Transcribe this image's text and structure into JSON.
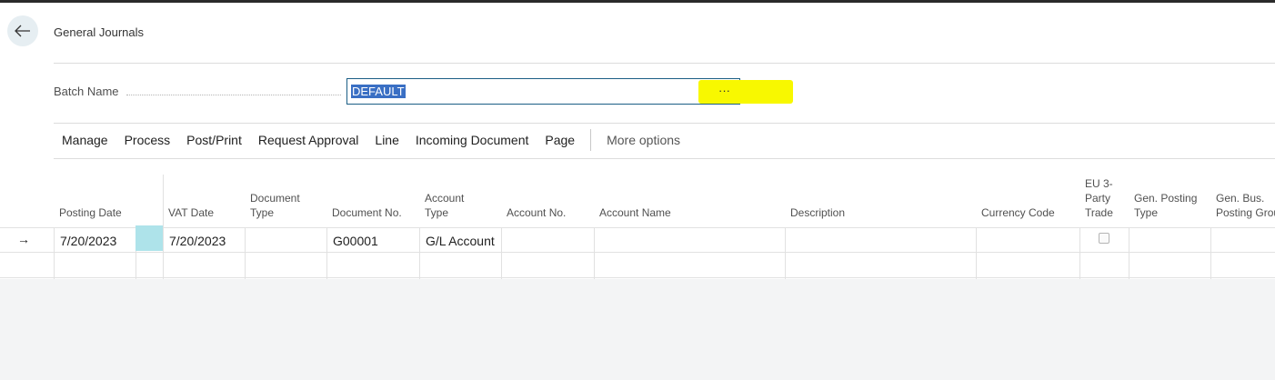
{
  "page": {
    "title": "General Journals"
  },
  "batch": {
    "label": "Batch Name",
    "value": "DEFAULT",
    "lookup": "···"
  },
  "actions": {
    "items": [
      "Manage",
      "Process",
      "Post/Print",
      "Request Approval",
      "Line",
      "Incoming Document",
      "Page"
    ],
    "more": "More options"
  },
  "grid": {
    "columns": {
      "posting_date": "Posting Date",
      "vat_date": "VAT Date",
      "document_type": "Document Type",
      "document_no": "Document No.",
      "account_type": "Account Type",
      "account_no": "Account No.",
      "account_name": "Account Name",
      "description": "Description",
      "currency_code": "Currency Code",
      "eu_3_party_trade": "EU 3-Party Trade",
      "gen_posting_type": "Gen. Posting Type",
      "gen_bus_posting_group": "Gen. Bus. Posting Grou"
    },
    "rows": [
      {
        "indicator": "→",
        "posting_date": "7/20/2023",
        "vat_date": "7/20/2023",
        "document_type": "",
        "document_no": "G00001",
        "account_type": "G/L Account",
        "account_no": "",
        "account_name": "",
        "description": "",
        "currency_code": "",
        "eu_3_party_trade": false,
        "gen_posting_type": "",
        "gen_bus_posting_group": ""
      }
    ]
  },
  "colors": {
    "highlight": "#f8f800",
    "selection": "#3a6fc4",
    "focus_border": "#1b5e85",
    "teal_cell": "#aee3ea"
  }
}
